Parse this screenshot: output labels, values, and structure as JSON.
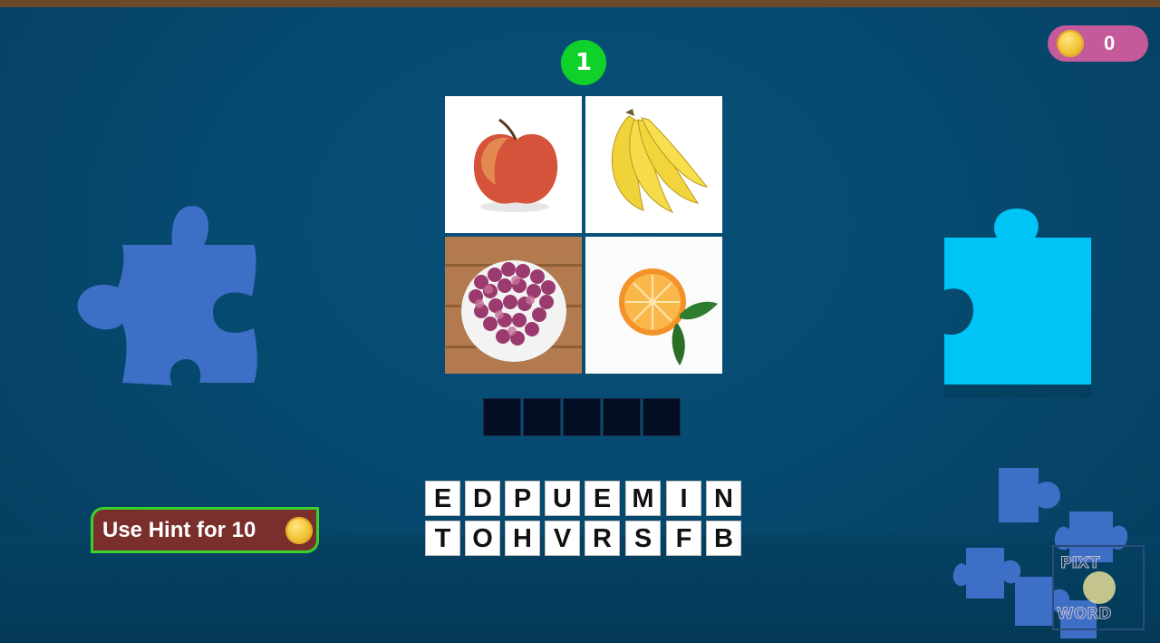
{
  "level": {
    "number": "1"
  },
  "coins": {
    "icon": "coin-icon",
    "count": "0"
  },
  "puzzle": {
    "images": [
      {
        "name": "apple",
        "icon": "apple-image"
      },
      {
        "name": "banana",
        "icon": "banana-image"
      },
      {
        "name": "grapes",
        "icon": "grapes-image"
      },
      {
        "name": "orange",
        "icon": "orange-image"
      }
    ],
    "answer_length": 5
  },
  "letters": {
    "row1": [
      "E",
      "D",
      "P",
      "U",
      "E",
      "M",
      "I",
      "N"
    ],
    "row2": [
      "T",
      "O",
      "H",
      "V",
      "R",
      "S",
      "F",
      "B"
    ]
  },
  "hint": {
    "label": "Use Hint for 10",
    "icon": "coin-icon"
  },
  "logo": {
    "line1": "PIXT",
    "line2": "WORD"
  },
  "colors": {
    "background": "#064a70",
    "level_badge": "#10d02a",
    "coin_pill": "#c55a9b",
    "hint_button": "#7a2f2c",
    "hint_border": "#3ad12a",
    "slot": "#030e24",
    "puzzle_left": "#3c6fc5",
    "puzzle_right": "#00c4f5"
  }
}
